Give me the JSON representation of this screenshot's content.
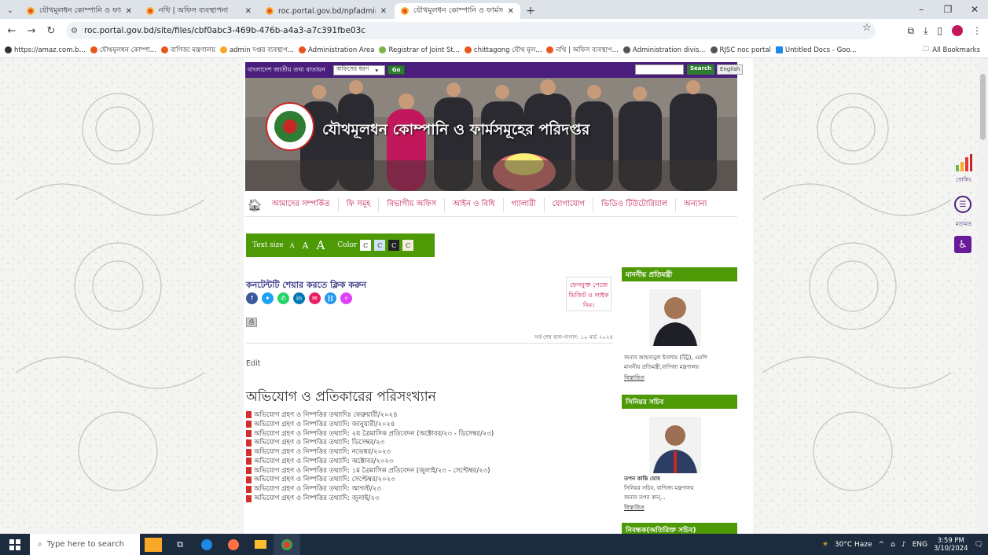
{
  "browser": {
    "tabs": [
      {
        "label": "যৌথমূলধন কোম্পানি ও ফার্মসমূ",
        "active": false
      },
      {
        "label": "নথি | অফিস ব্যবস্থাপনা",
        "active": false
      },
      {
        "label": "roc.portal.gov.bd/npfadmin/pu",
        "active": false
      },
      {
        "label": "যৌথমূলধন কোম্পানি ও ফার্মসমূ",
        "active": true
      }
    ],
    "new_tab": "+",
    "url": "roc.portal.gov.bd/site/files/cbf0abc3-469b-476b-a4a3-a7c391fbe03c",
    "bookmarks": [
      "https://amaz.com.b...",
      "যৌথমূলধন কোম্পা...",
      "বাণিজ্য মন্ত্রণালয়",
      "admin দপ্তর ব্যবস্থাপ...",
      "Administration Area",
      "Registrar of Joint St...",
      "chittagong যৌথ মূল...",
      "নথি | অফিস ব্যবস্থাপ...",
      "Administration divis...",
      "RJSC noc portal",
      "Untitled Docs - Goo..."
    ],
    "all_bookmarks": "All Bookmarks"
  },
  "site": {
    "portal_name": "বাংলাদেশ জাতীয় তথ্য বাতায়ন",
    "office_type": "অফিসের ধরণ",
    "go": "Go",
    "search": "Search",
    "english": "English",
    "banner_title": "যৌথমূলধন কোম্পানি ও ফার্মসমূহের পরিদপ্তর",
    "menu": [
      "আমাদের সম্পর্কিত",
      "ফি সমূহ",
      "বিভাগীয় অফিস",
      "আইন ও বিধি",
      "গ্যালারী",
      "যোগাযোগ",
      "ভিডিও টিউটোরিয়াল",
      "অন্যান্য"
    ],
    "text_size_label": "Text size",
    "size_a1": "A",
    "size_a2": "A",
    "size_a3": "A",
    "color_label": "Color",
    "color_c": "C",
    "share_heading": "কনটেন্টটি শেয়ার করতে ক্লিক করুন",
    "fb_like": "ফেসবুক্ত পেজে ভিজিট ও লাইক দিন।",
    "last_updated": "সর্ব-শেষ হাল-নাগাদ: ১০ মার্চ ২০২৪",
    "edit": "Edit",
    "page_title": "অভিযোগ ও প্রতিকারের পরিসংখ্যান",
    "documents": [
      "অভিযোগ গ্রহণ ও নিষ্পত্তির তথ্যাদিঃ ফেব্রুয়ারী/২০২৪",
      "অভিযোগ গ্রহণ ও নিষ্পত্তির তথ্যাদি: জানুয়ারী/২০২৪",
      "অভিযোগ গ্রহণ ও নিষ্পত্তির তথ্যাদি: ২য় ত্রৈমাসিক প্রতিবেদন (অক্টোবর/২৩ - ডিসেম্বর/২৩)",
      "অভিযোগ গ্রহণ ও নিষ্পত্তির তথ্যাদি: ডিসেম্বর/২৩",
      "অভিযোগ গ্রহণ ও নিষ্পত্তির তথ্যাদি: নভেম্বর/২০২৩",
      "অভিযোগ গ্রহণ ও নিষ্পত্তির তথ্যাদি: অক্টোবর/২০২৩",
      "অভিযোগ গ্রহণ ও নিষ্পত্তির তথ্যাদি: ১ম ত্রৈমাসিক প্রতিবেদন (জুলাই/২৩ - সেপ্টেম্বর/২৩)",
      "অভিযোগ গ্রহণ ও নিষ্পত্তির তথ্যাদি: সেপ্টেম্বর/২০২৩",
      "অভিযোগ গ্রহণ ও নিষ্পত্তির তথ্যাদি: আগস্ট/২৩",
      "অভিযোগ গ্রহণ ও নিষ্পত্তির তথ্যাদি: জুলাই/২৩"
    ],
    "sidebar": {
      "minister_heading": "মাননীয় প্রতিমন্ত্রী",
      "minister_name": "জনাব আহসানুল ইসলাম (টিটু), এমপি",
      "minister_title": "মাননীয় প্রতিমন্ত্রী,বাণিজ্য মন্ত্রণালয়",
      "details": "বিস্তারিত",
      "secretary_heading": "সিনিয়র সচিব",
      "secretary_name": "তপন কান্তি ঘোষ",
      "secretary_title": "সিনিয়র সচিব, বাণিজ্য মন্ত্রণালয়",
      "secretary_desc": "জনাব তপন কান্...",
      "next_heading": "নিবন্ধক(অতিরিক্ত সচিব)"
    },
    "side_icons": {
      "polling": "পোলিং",
      "feedback": "মতামত"
    }
  },
  "taskbar": {
    "search_placeholder": "Type here to search",
    "weather": "30°C Haze",
    "lang": "ENG",
    "time": "3:59 PM",
    "date": "3/10/2024"
  }
}
